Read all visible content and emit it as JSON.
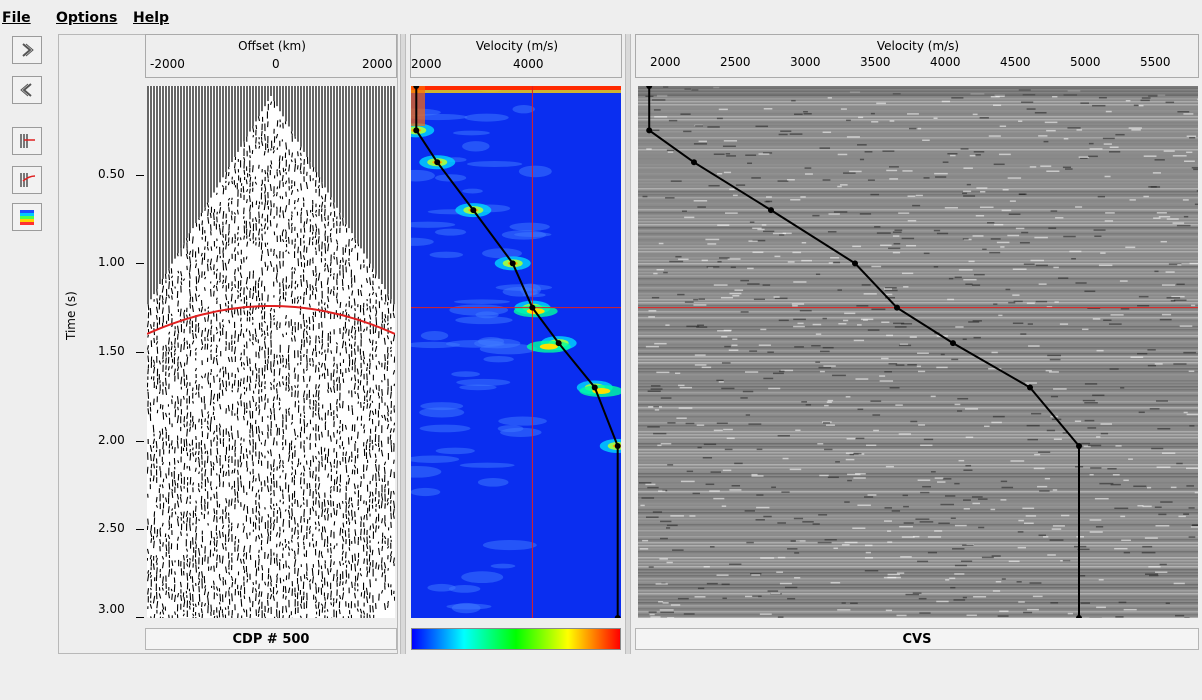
{
  "menu": {
    "file": "File",
    "options": "Options",
    "help": "Help"
  },
  "toolbar": {
    "buttons": [
      {
        "name": "next-arrow-icon"
      },
      {
        "name": "previous-arrow-icon"
      },
      {
        "name": "pick-mode-line-icon"
      },
      {
        "name": "pick-mode-curve-icon"
      },
      {
        "name": "colormap-icon"
      }
    ]
  },
  "time_axis": {
    "label": "Time (s)",
    "ticks": [
      "0.50",
      "1.00",
      "1.50",
      "2.00",
      "2.50",
      "3.00"
    ]
  },
  "gather_panel": {
    "title": "Offset (km)",
    "ticks": [
      "-2000",
      "0",
      "2000"
    ],
    "footer": "CDP # 500"
  },
  "semblance_panel": {
    "title": "Velocity (m/s)",
    "ticks": [
      "2000",
      "4000"
    ],
    "colorbar": [
      "#0000ff",
      "#00ffff",
      "#00ff00",
      "#ffff00",
      "#ff0000"
    ]
  },
  "cvs_panel": {
    "title": "Velocity (m/s)",
    "ticks": [
      "2000",
      "2500",
      "3000",
      "3500",
      "4000",
      "4500",
      "5000",
      "5500"
    ],
    "footer": "CVS"
  },
  "colors": {
    "pick_line": "#000000",
    "cursor": "#e02020",
    "nmo_curve": "#e02020",
    "semblance_bg": "#0a2ef0"
  },
  "chart_data": {
    "type": "line",
    "title": "",
    "xlabel": "Velocity (m/s)",
    "ylabel": "Time (s)",
    "xlim": [
      1800,
      5800
    ],
    "ylim": [
      3.0,
      0.0
    ],
    "picks_velocity_time": [
      [
        1880,
        0.0
      ],
      [
        1880,
        0.25
      ],
      [
        2200,
        0.43
      ],
      [
        2750,
        0.7
      ],
      [
        3350,
        1.0
      ],
      [
        3650,
        1.25
      ],
      [
        4050,
        1.45
      ],
      [
        4600,
        1.7
      ],
      [
        4950,
        2.03
      ],
      [
        4950,
        3.0
      ]
    ],
    "cursor": {
      "velocity": 3650,
      "time": 1.25
    }
  }
}
